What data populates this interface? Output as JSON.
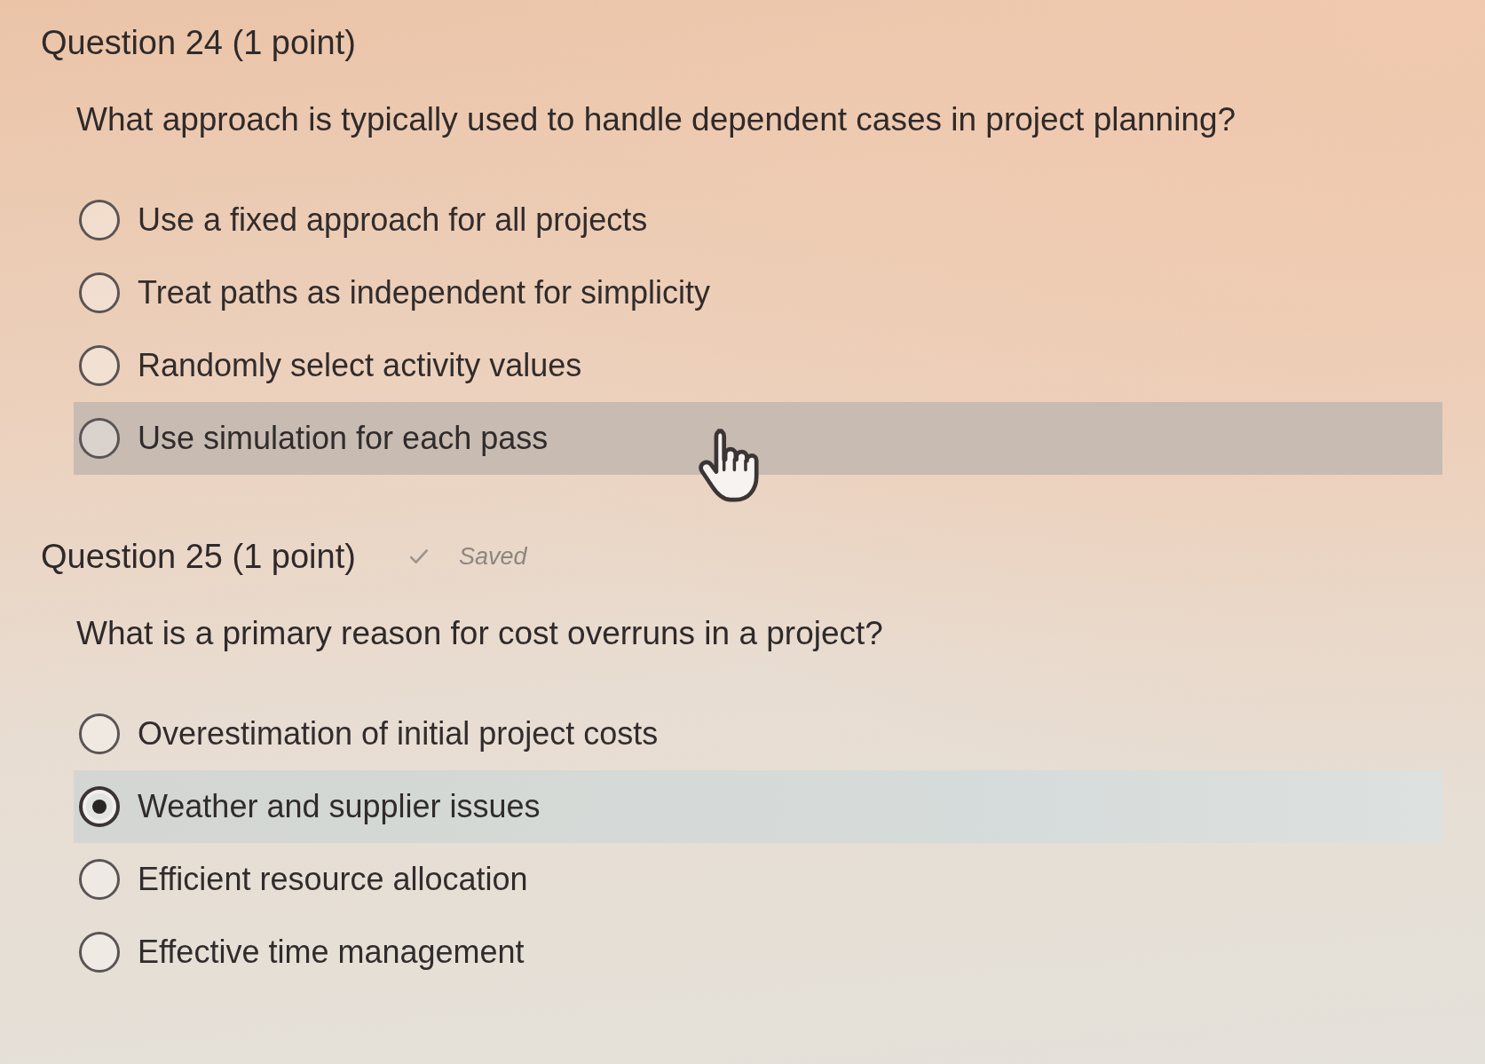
{
  "questions": [
    {
      "title": "Question 24 (1 point)",
      "prompt": "What approach is typically used to handle dependent cases in project planning?",
      "options": [
        {
          "label": "Use a fixed approach for all projects",
          "selected": false,
          "hovered": false
        },
        {
          "label": "Treat paths as independent for simplicity",
          "selected": false,
          "hovered": false
        },
        {
          "label": "Randomly select activity values",
          "selected": false,
          "hovered": false
        },
        {
          "label": "Use simulation for each pass",
          "selected": false,
          "hovered": true
        }
      ]
    },
    {
      "title": "Question 25 (1 point)",
      "save_status": "Saved",
      "prompt": "What is a primary reason for cost overruns in a project?",
      "options": [
        {
          "label": "Overestimation of initial project costs",
          "selected": false,
          "hovered": false
        },
        {
          "label": "Weather and supplier issues",
          "selected": true,
          "hovered": false
        },
        {
          "label": "Efficient resource allocation",
          "selected": false,
          "hovered": false
        },
        {
          "label": "Effective time management",
          "selected": false,
          "hovered": false
        }
      ]
    }
  ]
}
